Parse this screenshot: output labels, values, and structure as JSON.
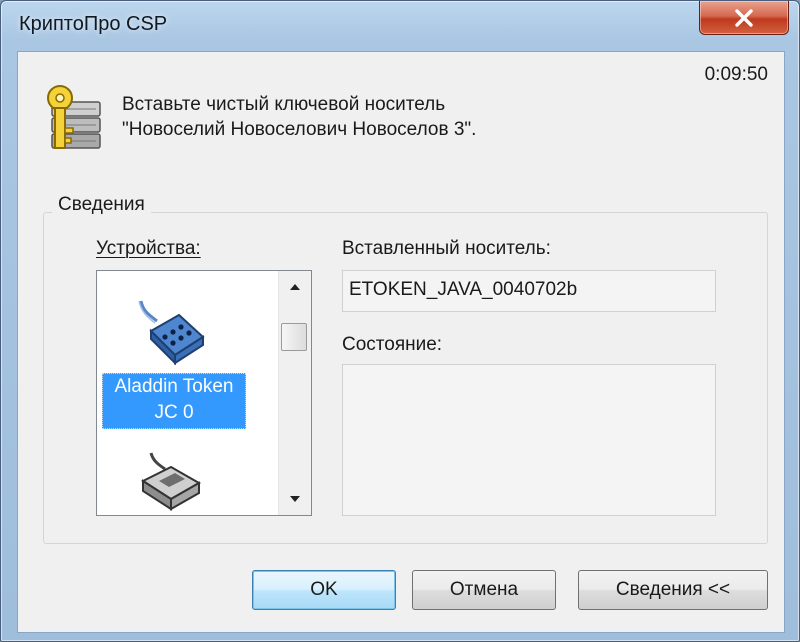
{
  "window": {
    "title": "КриптоПро CSP"
  },
  "timer": "0:09:50",
  "message": {
    "line1": "Вставьте чистый ключевой носитель",
    "line2": "\"Новоселий Новоселович Новоселов 3\"."
  },
  "group": {
    "label": "Сведения",
    "devices_label": "Устройства:",
    "inserted_label": "Вставленный носитель:",
    "inserted_value": "ETOKEN_JAVA_0040702b",
    "status_label": "Состояние:",
    "status_value": ""
  },
  "devices": [
    {
      "line1": "Aladdin Token",
      "line2": "JC 0",
      "selected": true,
      "icon": "usb-token-icon"
    },
    {
      "line1": "",
      "line2": "",
      "selected": false,
      "icon": "card-reader-icon"
    }
  ],
  "buttons": {
    "ok": "OK",
    "cancel": "Отмена",
    "details": "Сведения <<"
  },
  "colors": {
    "selection": "#3399ff",
    "close_button": "#c7412a"
  }
}
